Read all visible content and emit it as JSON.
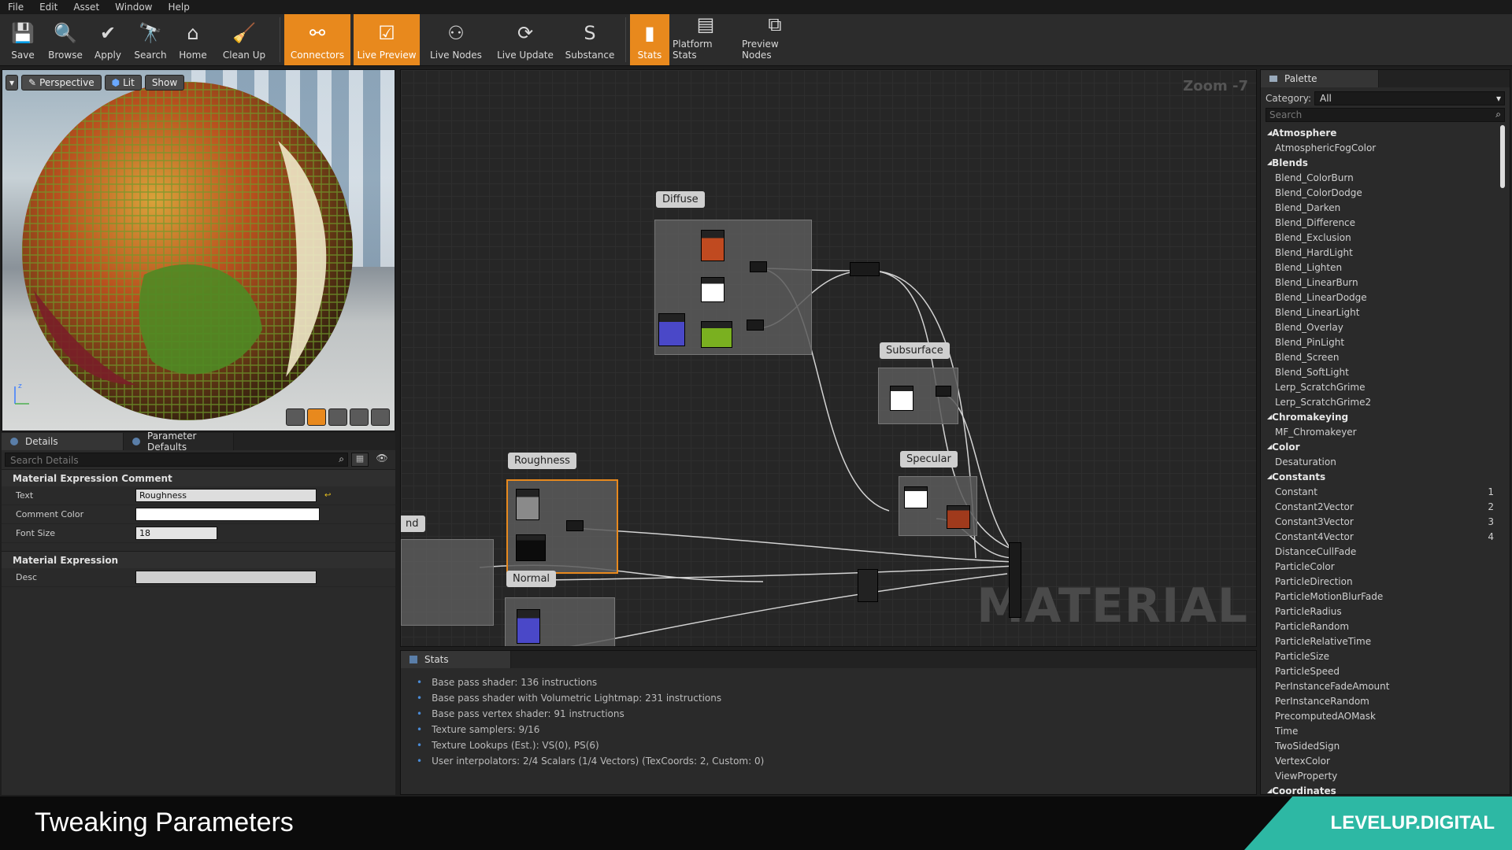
{
  "menu": [
    "File",
    "Edit",
    "Asset",
    "Window",
    "Help"
  ],
  "toolbar": [
    {
      "label": "Save",
      "icon": "save-icon",
      "active": false
    },
    {
      "label": "Browse",
      "icon": "browse-icon",
      "active": false
    },
    {
      "label": "Apply",
      "icon": "apply-icon",
      "active": false
    },
    {
      "label": "Search",
      "icon": "search-icon",
      "active": false
    },
    {
      "label": "Home",
      "icon": "home-icon",
      "active": false
    },
    {
      "label": "Clean Up",
      "icon": "clean-up-icon",
      "active": false
    },
    {
      "label": "Connectors",
      "icon": "connectors-icon",
      "active": true
    },
    {
      "label": "Live Preview",
      "icon": "live-preview-icon",
      "active": true
    },
    {
      "label": "Live Nodes",
      "icon": "live-nodes-icon",
      "active": false
    },
    {
      "label": "Live Update",
      "icon": "live-update-icon",
      "active": false
    },
    {
      "label": "Substance",
      "icon": "substance-icon",
      "active": false
    },
    {
      "label": "Stats",
      "icon": "stats-icon",
      "active": true
    },
    {
      "label": "Platform Stats",
      "icon": "platform-stats-icon",
      "active": false
    },
    {
      "label": "Preview Nodes",
      "icon": "preview-nodes-icon",
      "active": false
    }
  ],
  "viewport": {
    "perspective": "Perspective",
    "lit": "Lit",
    "show": "Show"
  },
  "details": {
    "tab1": "Details",
    "tab2": "Parameter Defaults",
    "search_placeholder": "Search Details",
    "section1": "Material Expression Comment",
    "text_label": "Text",
    "text_value": "Roughness",
    "color_label": "Comment Color",
    "fontsize_label": "Font Size",
    "fontsize_value": "18",
    "section2": "Material Expression",
    "desc_label": "Desc"
  },
  "graph": {
    "zoom": "Zoom -7",
    "watermark": "MATERIAL",
    "labels": {
      "diffuse": "Diffuse",
      "subsurface": "Subsurface",
      "specular": "Specular",
      "roughness": "Roughness",
      "normal": "Normal",
      "nd": "nd"
    }
  },
  "stats": {
    "tab": "Stats",
    "lines": [
      "Base pass shader: 136 instructions",
      "Base pass shader with Volumetric Lightmap: 231 instructions",
      "Base pass vertex shader: 91 instructions",
      "Texture samplers: 9/16",
      "Texture Lookups (Est.): VS(0), PS(6)",
      "User interpolators: 2/4 Scalars (1/4 Vectors) (TexCoords: 2, Custom: 0)"
    ]
  },
  "palette": {
    "tab": "Palette",
    "category_label": "Category:",
    "category_value": "All",
    "search_placeholder": "Search",
    "entries": [
      {
        "cat": "Atmosphere"
      },
      {
        "item": "AtmosphericFogColor"
      },
      {
        "cat": "Blends"
      },
      {
        "item": "Blend_ColorBurn"
      },
      {
        "item": "Blend_ColorDodge"
      },
      {
        "item": "Blend_Darken"
      },
      {
        "item": "Blend_Difference"
      },
      {
        "item": "Blend_Exclusion"
      },
      {
        "item": "Blend_HardLight"
      },
      {
        "item": "Blend_Lighten"
      },
      {
        "item": "Blend_LinearBurn"
      },
      {
        "item": "Blend_LinearDodge"
      },
      {
        "item": "Blend_LinearLight"
      },
      {
        "item": "Blend_Overlay"
      },
      {
        "item": "Blend_PinLight"
      },
      {
        "item": "Blend_Screen"
      },
      {
        "item": "Blend_SoftLight"
      },
      {
        "item": "Lerp_ScratchGrime"
      },
      {
        "item": "Lerp_ScratchGrime2"
      },
      {
        "cat": "Chromakeying"
      },
      {
        "item": "MF_Chromakeyer"
      },
      {
        "cat": "Color"
      },
      {
        "item": "Desaturation"
      },
      {
        "cat": "Constants"
      },
      {
        "item": "Constant",
        "key": "1"
      },
      {
        "item": "Constant2Vector",
        "key": "2"
      },
      {
        "item": "Constant3Vector",
        "key": "3"
      },
      {
        "item": "Constant4Vector",
        "key": "4"
      },
      {
        "item": "DistanceCullFade"
      },
      {
        "item": "ParticleColor"
      },
      {
        "item": "ParticleDirection"
      },
      {
        "item": "ParticleMotionBlurFade"
      },
      {
        "item": "ParticleRadius"
      },
      {
        "item": "ParticleRandom"
      },
      {
        "item": "ParticleRelativeTime"
      },
      {
        "item": "ParticleSize"
      },
      {
        "item": "ParticleSpeed"
      },
      {
        "item": "PerInstanceFadeAmount"
      },
      {
        "item": "PerInstanceRandom"
      },
      {
        "item": "PrecomputedAOMask"
      },
      {
        "item": "Time"
      },
      {
        "item": "TwoSidedSign"
      },
      {
        "item": "VertexColor"
      },
      {
        "item": "ViewProperty"
      },
      {
        "cat": "Coordinates"
      }
    ]
  },
  "footer": {
    "title": "Tweaking Parameters",
    "brand": "LEVELUP.DIGITAL"
  },
  "colors": {
    "accent": "#e8891d",
    "brand": "#2db8a4"
  }
}
